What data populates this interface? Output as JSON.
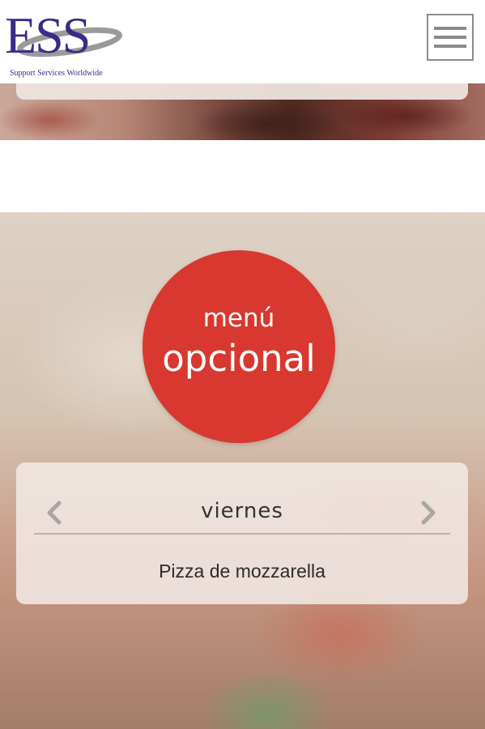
{
  "header": {
    "logo_text": "ESS",
    "logo_tagline": "Support Services Worldwide",
    "menu_icon": "hamburger-menu-icon",
    "brand_color": "#3d2a86"
  },
  "hero": {
    "badge_line1": "menú",
    "badge_line2": "opcional",
    "badge_color": "#d8382f",
    "day_label": "viernes",
    "dish": "Pizza de mozzarella",
    "prev_icon": "chevron-left-icon",
    "next_icon": "chevron-right-icon"
  }
}
